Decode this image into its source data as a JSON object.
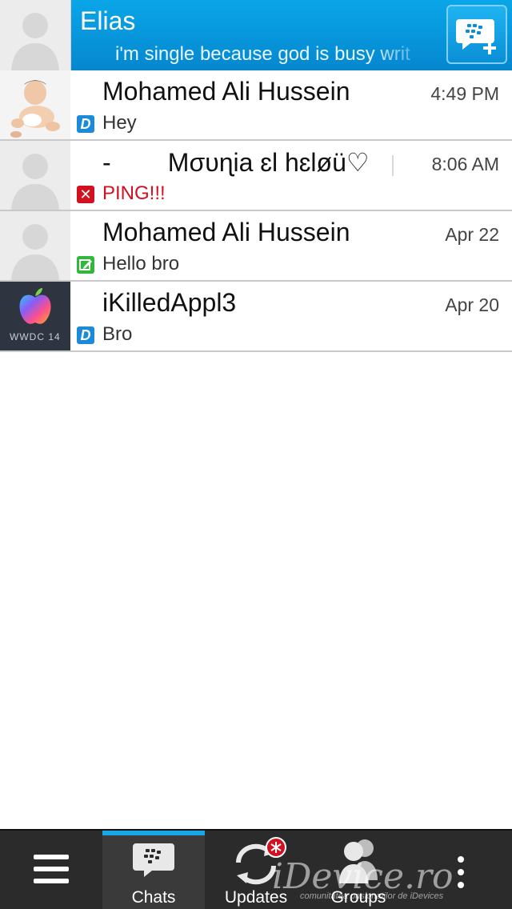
{
  "header": {
    "name": "Elias",
    "status": "i'm single because god is busy writ",
    "new_chat_icon": "bbm-new-chat-icon"
  },
  "chats": [
    {
      "title": "Mohamed Ali Hussein",
      "time": "4:49 PM",
      "status_icon": "delivered-D",
      "status_glyph": "D",
      "preview": "Hey",
      "preview_color": "#333333",
      "avatar": "baby-photo"
    },
    {
      "title": "-        Mσυɳia ɛl hɛløü♡",
      "time": "8:06 AM",
      "status_icon": "failed-x",
      "status_glyph": "✕",
      "preview": "PING!!!",
      "preview_color": "#d11020",
      "avatar": "default-silhouette"
    },
    {
      "title": "Mohamed Ali Hussein",
      "time": "Apr 22",
      "status_icon": "draft-edit",
      "status_glyph": "",
      "preview": "Hello bro",
      "preview_color": "#333333",
      "avatar": "default-silhouette"
    },
    {
      "title": "iKilledAppl3",
      "time": "Apr 20",
      "status_icon": "delivered-D",
      "status_glyph": "D",
      "preview": "Bro",
      "preview_color": "#333333",
      "avatar": "wwdc-apple-logo",
      "avatar_caption": "WWDC 14"
    }
  ],
  "tabs": {
    "menu_icon": "hamburger-menu-icon",
    "chats_label": "Chats",
    "updates_label": "Updates",
    "groups_label": "Groups",
    "more_icon": "overflow-dots-icon"
  },
  "watermark": {
    "text": "iDevice.ro",
    "subtext": "comunitatea pasionatilor de iDevices"
  },
  "colors": {
    "header_blue": "#0a97dc",
    "accent": "#17a6e6",
    "error_red": "#d11020",
    "draft_green": "#2fb83a"
  }
}
